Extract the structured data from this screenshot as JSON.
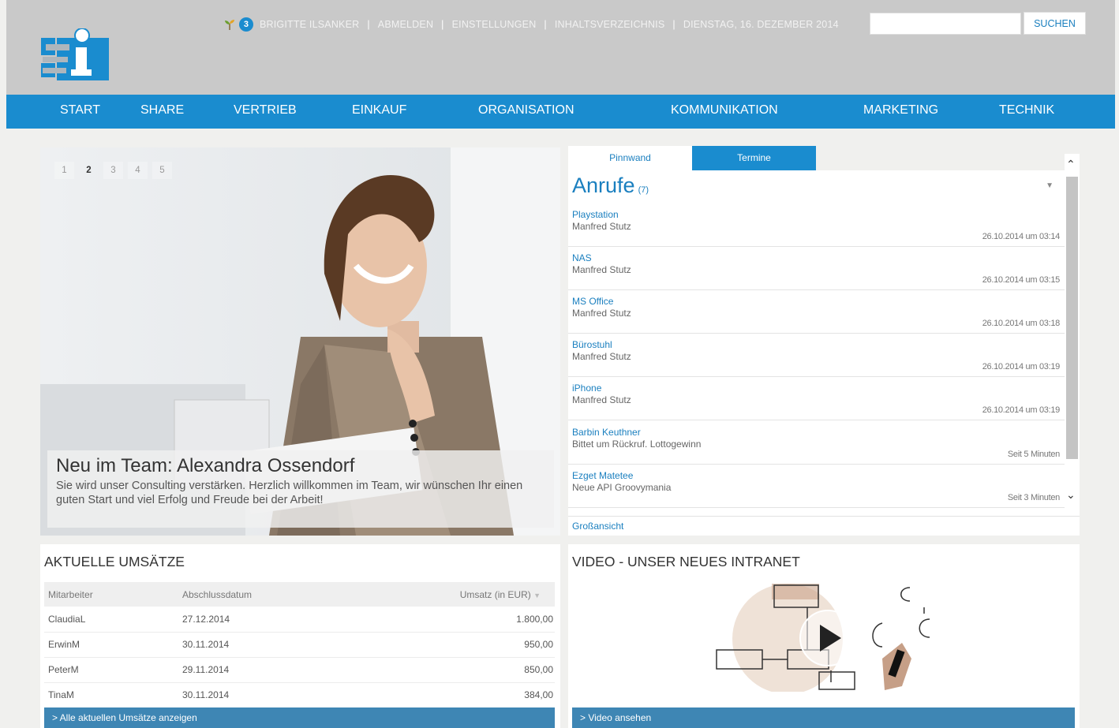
{
  "header": {
    "notification_count": "3",
    "user": "BRIGITTE ILSANKER",
    "links": [
      "ABMELDEN",
      "EINSTELLUNGEN",
      "INHALTSVERZEICHNIS"
    ],
    "date": "DIENSTAG, 16. DEZEMBER 2014",
    "search": {
      "placeholder": "",
      "button": "SUCHEN"
    }
  },
  "nav": [
    "START",
    "SHARE",
    "VERTRIEB",
    "EINKAUF",
    "ORGANISATION",
    "KOMMUNIKATION",
    "MARKETING",
    "TECHNIK"
  ],
  "slider": {
    "pages": [
      "1",
      "2",
      "3",
      "4",
      "5"
    ],
    "active_page": "2",
    "title": "Neu im Team: Alexandra Ossendorf",
    "text": "Sie wird unser Consulting verstärken. Herzlich willkommen im Team, wir wünschen Ihr einen guten Start und viel Erfolg und Freude bei der Arbeit!"
  },
  "panel": {
    "tabs": [
      "Pinnwand",
      "Termine"
    ],
    "active_tab": "Termine",
    "title": "Anrufe",
    "count": "(7)",
    "items": [
      {
        "title": "Playstation",
        "sub": "Manfred Stutz",
        "time": "26.10.2014 um 03:14"
      },
      {
        "title": "NAS",
        "sub": "Manfred Stutz",
        "time": "26.10.2014 um 03:15"
      },
      {
        "title": "MS Office",
        "sub": "Manfred Stutz",
        "time": "26.10.2014 um 03:18"
      },
      {
        "title": "Bürostuhl",
        "sub": "Manfred Stutz",
        "time": "26.10.2014 um 03:19"
      },
      {
        "title": "iPhone",
        "sub": "Manfred Stutz",
        "time": "26.10.2014 um 03:19"
      },
      {
        "title": "Barbin Keuthner",
        "sub": "Bittet um Rückruf. Lottogewinn",
        "time": "Seit 5 Minuten"
      },
      {
        "title": "Ezget Matetee",
        "sub": "Neue API Groovymania",
        "time": "Seit 3 Minuten"
      }
    ],
    "footer_link": "Großansicht"
  },
  "sales": {
    "title": "AKTUELLE UMSÄTZE",
    "columns": [
      "Mitarbeiter",
      "Abschlussdatum",
      "Umsatz (in EUR)"
    ],
    "rows": [
      [
        "ClaudiaL",
        "27.12.2014",
        "1.800,00"
      ],
      [
        "ErwinM",
        "30.11.2014",
        "950,00"
      ],
      [
        "PeterM",
        "29.11.2014",
        "850,00"
      ],
      [
        "TinaM",
        "30.11.2014",
        "384,00"
      ]
    ],
    "footer_link": "> Alle aktuellen Umsätze anzeigen"
  },
  "video": {
    "title": "VIDEO - UNSER NEUES INTRANET",
    "footer_link": "> Video ansehen"
  },
  "colors": {
    "accent": "#1a8ccf",
    "header_bg": "#c9c9c9",
    "link": "#1a7fbf",
    "footer_bar": "#3e86b4"
  }
}
